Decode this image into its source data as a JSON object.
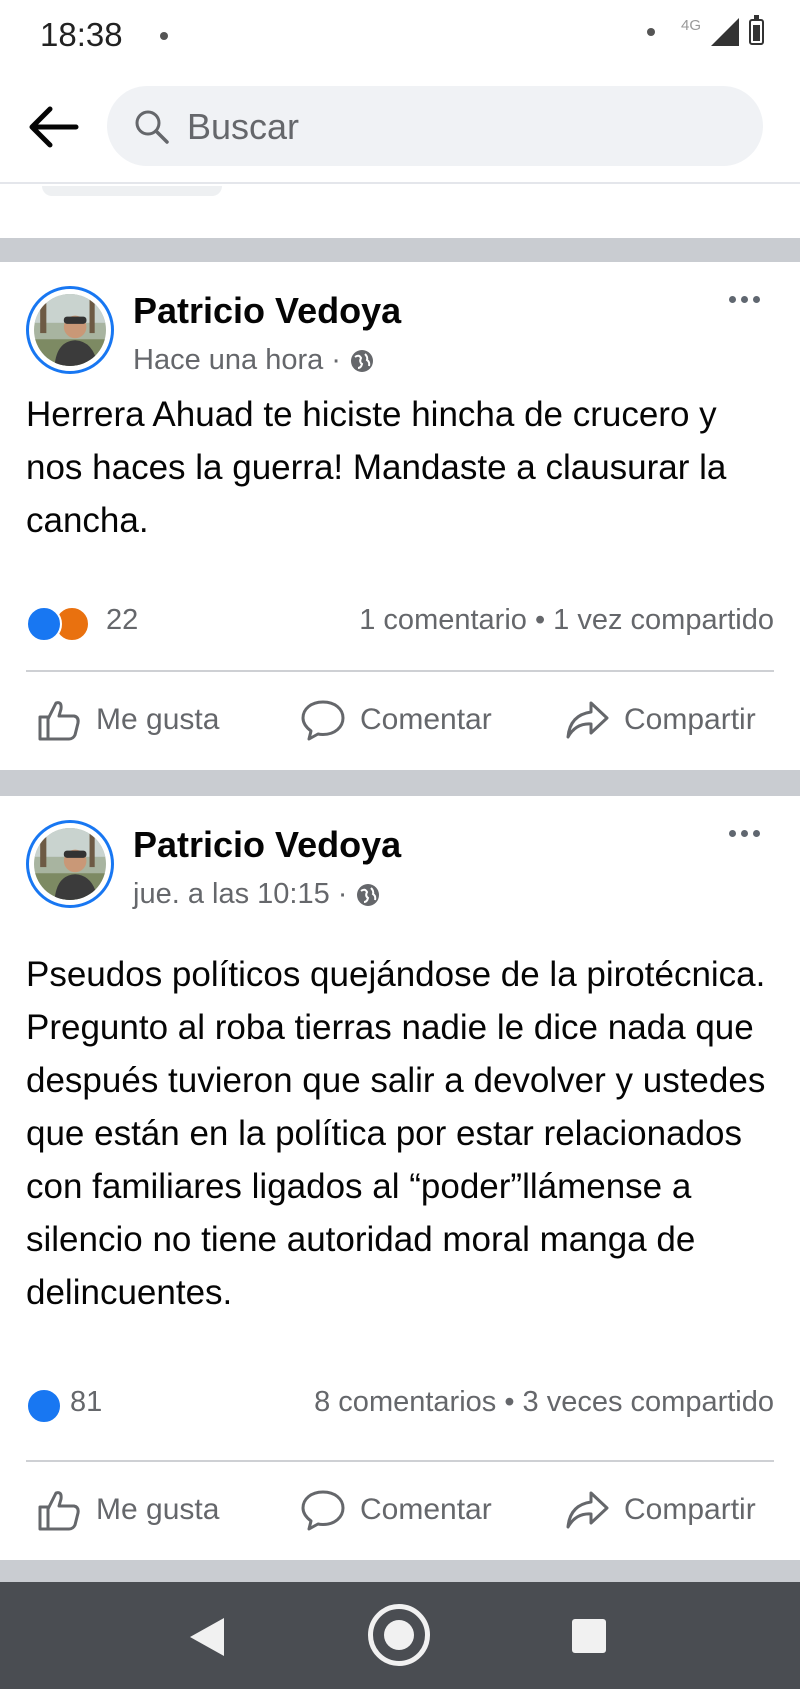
{
  "status_bar": {
    "time": "18:38",
    "network": "4G"
  },
  "header": {
    "search_placeholder": "Buscar"
  },
  "posts": [
    {
      "author": "Patricio Vedoya",
      "timestamp": "Hace una hora ·",
      "text": "Herrera Ahuad te hiciste hincha de crucero y nos haces la guerra! Mandaste a clausurar la cancha.",
      "reaction_count": "22",
      "reactions": [
        "like",
        "angry"
      ],
      "share_stats": "1 comentario • 1 vez compartido",
      "actions": {
        "like": "Me gusta",
        "comment": "Comentar",
        "share": "Compartir"
      }
    },
    {
      "author": "Patricio Vedoya",
      "timestamp": "jue. a las 10:15 ·",
      "text": "Pseudos políticos quejándose de la pirotécnica. Pregunto al roba tierras nadie le dice nada que después tuvieron que salir a devolver y ustedes que están en la política por estar relacionados  con familiares ligados al “poder”llámense a silencio no tiene autoridad moral manga de delincuentes.",
      "reaction_count": "81",
      "reactions": [
        "like"
      ],
      "share_stats": "8 comentarios • 3 veces compartido",
      "actions": {
        "like": "Me gusta",
        "comment": "Comentar",
        "share": "Compartir"
      }
    }
  ],
  "colors": {
    "facebook_blue": "#1877f2",
    "angry_orange": "#e9710f",
    "nav_bar": "#4a4d52",
    "separator": "#c9ccd1"
  }
}
